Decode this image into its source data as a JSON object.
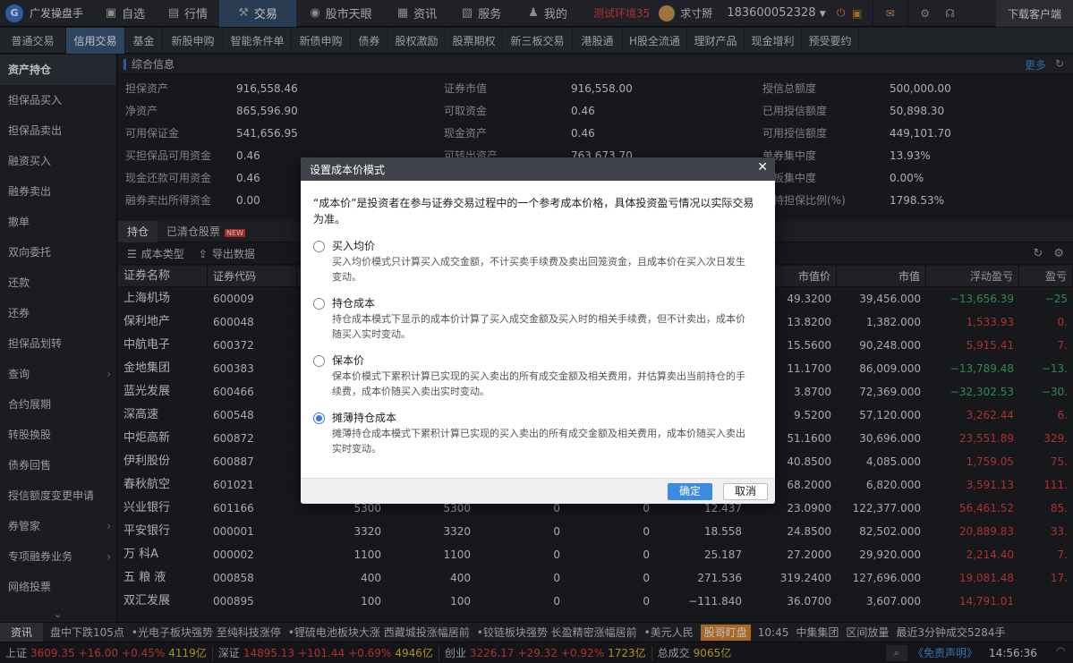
{
  "topbar": {
    "brand": "广发操盘手",
    "nav": [
      {
        "icon": "grid-icon",
        "glyph": "▣",
        "label": "自选"
      },
      {
        "icon": "chart-icon",
        "glyph": "▤",
        "label": "行情"
      },
      {
        "icon": "trade-icon",
        "glyph": "⚒",
        "label": "交易"
      },
      {
        "icon": "eye-icon",
        "glyph": "◉",
        "label": "股市天眼"
      },
      {
        "icon": "news-icon",
        "glyph": "▦",
        "label": "资讯"
      },
      {
        "icon": "briefcase-icon",
        "glyph": "▧",
        "label": "服务"
      },
      {
        "icon": "person-icon",
        "glyph": "♟",
        "label": "我的"
      }
    ],
    "env": "测试环境35",
    "username": "求寸掰",
    "phone": "183600052328",
    "download": "下载客户端"
  },
  "subnav": [
    "普通交易",
    "信用交易",
    "基金",
    "新股申购",
    "智能条件单",
    "新债申购",
    "债券",
    "股权激励",
    "股票期权",
    "新三板交易",
    "港股通",
    "H股全流通",
    "理财产品",
    "现金增利",
    "预受要约"
  ],
  "sidebar": [
    "资产持仓",
    "担保品买入",
    "担保品卖出",
    "融资买入",
    "融券卖出",
    "撤单",
    "双向委托",
    "还款",
    "还券",
    "担保品划转",
    "查询",
    "合约展期",
    "转股换股",
    "债券回售",
    "授信额度变更申请",
    "券管家",
    "专项融券业务",
    "网络投票"
  ],
  "summary": {
    "title": "综合信息",
    "more": "更多",
    "col1": [
      [
        "担保资产",
        "916,558.46"
      ],
      [
        "净资产",
        "865,596.90"
      ],
      [
        "可用保证金",
        "541,656.95"
      ],
      [
        "买担保品可用资金",
        "0.46"
      ],
      [
        "现金还款可用资金",
        "0.46"
      ],
      [
        "融券卖出所得资金",
        "0.00"
      ]
    ],
    "col2": [
      [
        "证券市值",
        "916,558.00"
      ],
      [
        "可取资金",
        "0.46"
      ],
      [
        "现金资产",
        "0.46"
      ],
      [
        "可转出资产",
        "763,673.70"
      ]
    ],
    "col3": [
      [
        "授信总额度",
        "500,000.00"
      ],
      [
        "已用授信额度",
        "50,898.30"
      ],
      [
        "可用授信额度",
        "449,101.70"
      ],
      [
        "单券集中度",
        "13.93%"
      ],
      [
        "创板集中度",
        "0.00%"
      ],
      [
        "维持担保比例(%)",
        "1798.53%"
      ]
    ]
  },
  "holdtabs": {
    "tab1": "持仓",
    "tab2": "已清仓股票",
    "badge": "NEW"
  },
  "tools": {
    "t1": "成本类型",
    "t2": "导出数据"
  },
  "table": {
    "headers": [
      "证券名称",
      "证券代码",
      "",
      "",
      "",
      "",
      "",
      "市值价",
      "市值",
      "浮动盈亏",
      "盈亏"
    ],
    "rows": [
      [
        "上海机场",
        "600009",
        "",
        "",
        "",
        "",
        "",
        "49.3200",
        "39,456.000",
        "−13,656.39",
        "−25"
      ],
      [
        "保利地产",
        "600048",
        "",
        "",
        "",
        "",
        "",
        "13.8200",
        "1,382.000",
        "1,533.93",
        "0."
      ],
      [
        "中航电子",
        "600372",
        "",
        "",
        "",
        "",
        "",
        "15.5600",
        "90,248.000",
        "5,915.41",
        "7."
      ],
      [
        "金地集团",
        "600383",
        "",
        "",
        "",
        "",
        "",
        "11.1700",
        "86,009.000",
        "−13,789.48",
        "−13."
      ],
      [
        "蓝光发展",
        "600466",
        "",
        "",
        "",
        "",
        "",
        "3.8700",
        "72,369.000",
        "−32,302.53",
        "−30."
      ],
      [
        "深高速",
        "600548",
        "",
        "",
        "",
        "",
        "",
        "9.5200",
        "57,120.000",
        "3,262.44",
        "6."
      ],
      [
        "中炬高新",
        "600872",
        "",
        "",
        "",
        "",
        "",
        "51.1600",
        "30,696.000",
        "23,551.89",
        "329."
      ],
      [
        "伊利股份",
        "600887",
        "",
        "",
        "",
        "",
        "",
        "40.8500",
        "4,085.000",
        "1,759.05",
        "75."
      ],
      [
        "春秋航空",
        "601021",
        "",
        "",
        "",
        "",
        "",
        "68.2000",
        "6,820.000",
        "3,591.13",
        "111."
      ],
      [
        "兴业银行",
        "601166",
        "5300",
        "5300",
        "0",
        "0",
        "12.437",
        "23.0900",
        "122,377.000",
        "56,461.52",
        "85."
      ],
      [
        "平安银行",
        "000001",
        "3320",
        "3320",
        "0",
        "0",
        "18.558",
        "24.8500",
        "82,502.000",
        "20,889.83",
        "33."
      ],
      [
        "万 科A",
        "000002",
        "1100",
        "1100",
        "0",
        "0",
        "25.187",
        "27.2000",
        "29,920.000",
        "2,214.40",
        "7."
      ],
      [
        "五 粮 液",
        "000858",
        "400",
        "400",
        "0",
        "0",
        "271.536",
        "319.2400",
        "127,696.000",
        "19,081.48",
        "17."
      ],
      [
        "双汇发展",
        "000895",
        "100",
        "100",
        "0",
        "0",
        "−111.840",
        "36.0700",
        "3,607.000",
        "14,791.01",
        ""
      ]
    ],
    "neg": [
      0,
      3,
      4
    ]
  },
  "ticker": {
    "label": "资讯",
    "items": [
      "盘中下跌105点",
      "•光电子板块强势 至纯科技涨停",
      "•锂硫电池板块大涨 西藏城投涨幅居前",
      "•铰链板块强势 长盈精密涨幅居前",
      "•美元人民"
    ],
    "highlight": "股哥盯盘",
    "time": "10:45",
    "item2": "中集集团",
    "item3": "区间放量",
    "item4": "最近3分钟成交5284手"
  },
  "status": {
    "sh": [
      "上证",
      "3609.35",
      "+16.00",
      "+0.45%",
      "4119亿"
    ],
    "sz": [
      "深证",
      "14895.13",
      "+101.44",
      "+0.69%",
      "4946亿"
    ],
    "cy": [
      "创业",
      "3226.17",
      "+29.32",
      "+0.92%",
      "1723亿"
    ],
    "total": [
      "总成交",
      "9065亿"
    ],
    "disclaimer": "《免责声明》",
    "clock": "14:56:36"
  },
  "modal": {
    "title": "设置成本价模式",
    "desc": "“成本价”是投资者在参与证券交易过程中的一个参考成本价格，具体投资盈亏情况以实际交易为准。",
    "options": [
      {
        "title": "买入均价",
        "text": "买入均价模式只计算买入成交金额，不计买卖手续费及卖出回笼资金，且成本价在买入次日发生变动。",
        "checked": false
      },
      {
        "title": "持仓成本",
        "text": "持仓成本模式下显示的成本价计算了买入成交金额及买入时的相关手续费，但不计卖出，成本价随买入实时变动。",
        "checked": false
      },
      {
        "title": "保本价",
        "text": "保本价模式下累积计算已实现的买入卖出的所有成交金额及相关费用，并估算卖出当前持仓的手续费，成本价随买入卖出实时变动。",
        "checked": false
      },
      {
        "title": "摊薄持仓成本",
        "text": "摊薄持仓成本模式下累积计算已实现的买入卖出的所有成交金额及相关费用，成本价随买入卖出实时变动。",
        "checked": true
      }
    ],
    "ok": "确定",
    "cancel": "取消"
  }
}
